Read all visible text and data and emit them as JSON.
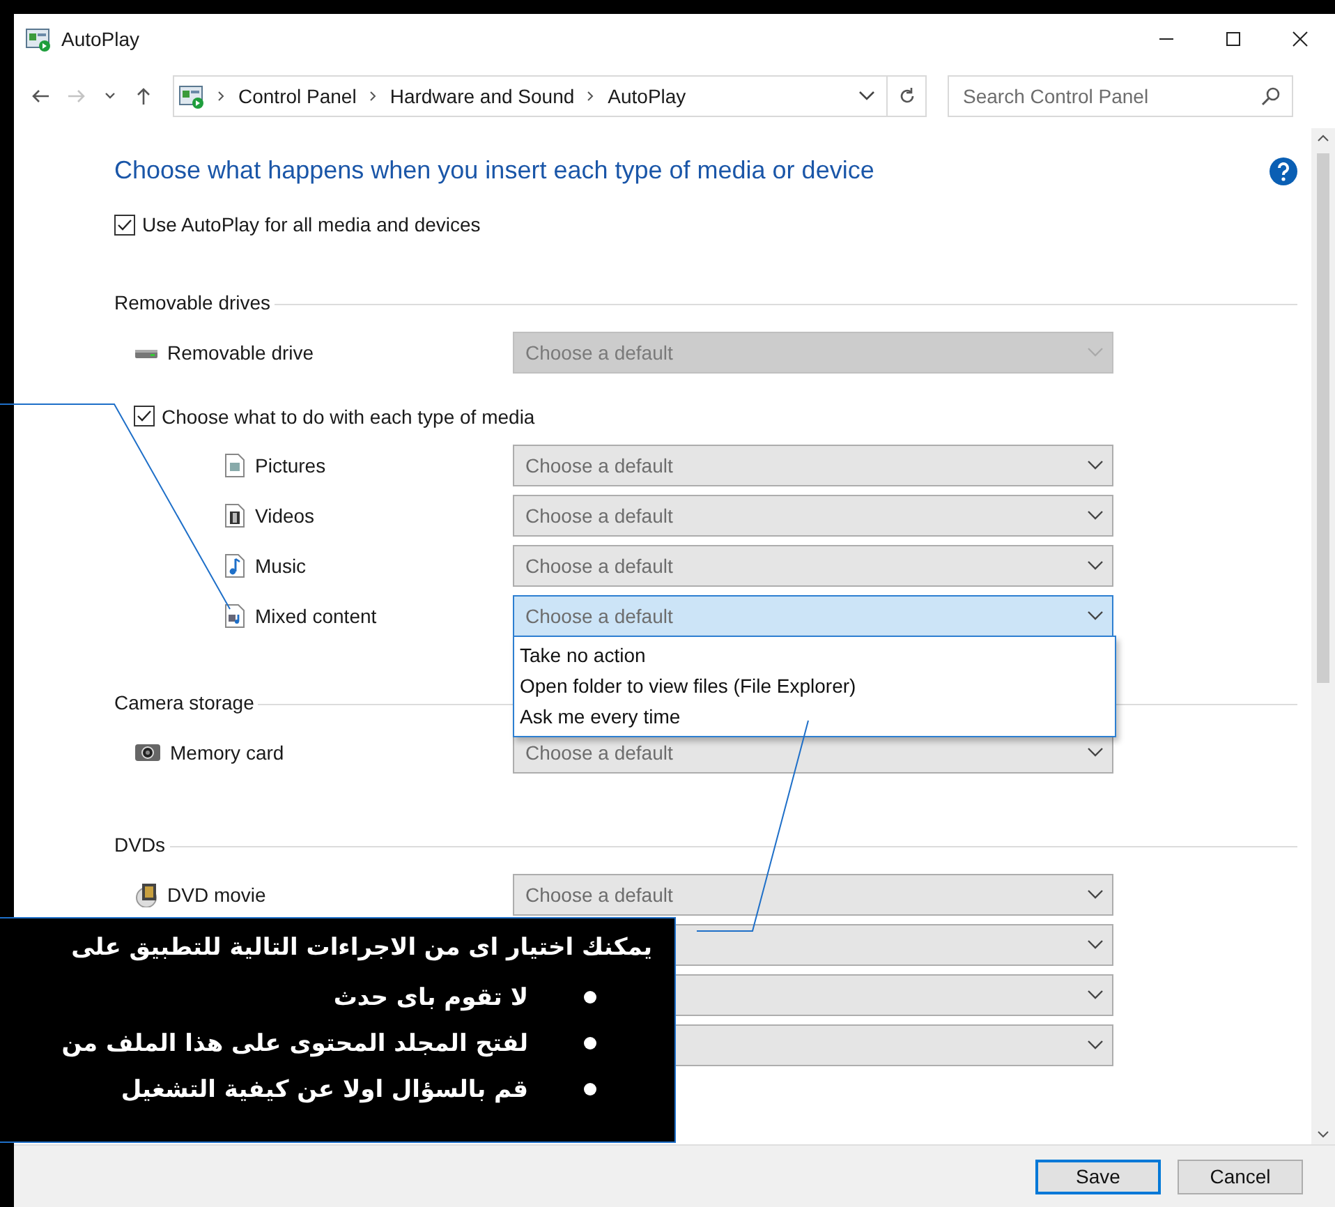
{
  "window": {
    "title": "AutoPlay"
  },
  "nav": [
    {
      "kind": "back",
      "disabled": false
    },
    {
      "kind": "forward",
      "disabled": true
    },
    {
      "kind": "recent",
      "disabled": false
    },
    {
      "kind": "up",
      "disabled": false
    }
  ],
  "address": {
    "crumbs": [
      "Control Panel",
      "Hardware and Sound",
      "AutoPlay"
    ]
  },
  "search": {
    "placeholder": "Search Control Panel"
  },
  "heading": "Choose what happens when you insert each type of media or device",
  "use_autoplay": {
    "label": "Use AutoPlay for all media and devices",
    "checked": true
  },
  "sections": [
    {
      "title": "Removable drives",
      "rows": [
        {
          "kind": "drive",
          "label": "Removable drive",
          "dropdown": {
            "value": "Choose a default",
            "disabled": true,
            "expanded": false
          }
        },
        {
          "kind": "checkbox",
          "label": "Choose what to do with each type of media",
          "checked": true
        },
        {
          "kind": "pictures",
          "label": "Pictures",
          "dropdown": {
            "value": "Choose a default",
            "disabled": false,
            "expanded": false
          }
        },
        {
          "kind": "videos",
          "label": "Videos",
          "dropdown": {
            "value": "Choose a default",
            "disabled": false,
            "expanded": false
          }
        },
        {
          "kind": "music",
          "label": "Music",
          "dropdown": {
            "value": "Choose a default",
            "disabled": false,
            "expanded": false
          }
        },
        {
          "kind": "mixed",
          "label": "Mixed content",
          "dropdown": {
            "value": "Choose a default",
            "disabled": false,
            "expanded": true,
            "options": [
              "Take no action",
              "Open folder to view files (File Explorer)",
              "Ask me every time"
            ]
          }
        }
      ]
    },
    {
      "title": "Camera storage",
      "rows": [
        {
          "kind": "memory-card",
          "label": "Memory card",
          "dropdown": {
            "value": "Choose a default",
            "disabled": false,
            "expanded": false
          }
        }
      ]
    },
    {
      "title": "DVDs",
      "rows": [
        {
          "kind": "dvd",
          "label": "DVD movie",
          "dropdown": {
            "value": "Choose a default",
            "disabled": false,
            "expanded": false
          }
        },
        {
          "kind": "covered",
          "dropdown": {
            "disabled": false,
            "expanded": false
          }
        },
        {
          "kind": "covered",
          "dropdown": {
            "disabled": false,
            "expanded": false
          }
        },
        {
          "kind": "covered",
          "dropdown": {
            "disabled": false,
            "expanded": false
          }
        }
      ]
    }
  ],
  "buttons": [
    {
      "label": "Save",
      "default": true
    },
    {
      "label": "Cancel",
      "default": false
    }
  ],
  "callout": {
    "title": "يمكنك اختيار اى من الاجراءات التالية للتطبيق على",
    "bullets": [
      "لا تقوم باى حدث",
      "لفتح المجلد المحتوى على هذا الملف من",
      "قم بالسؤال اولا عن كيفية التشغيل"
    ]
  }
}
